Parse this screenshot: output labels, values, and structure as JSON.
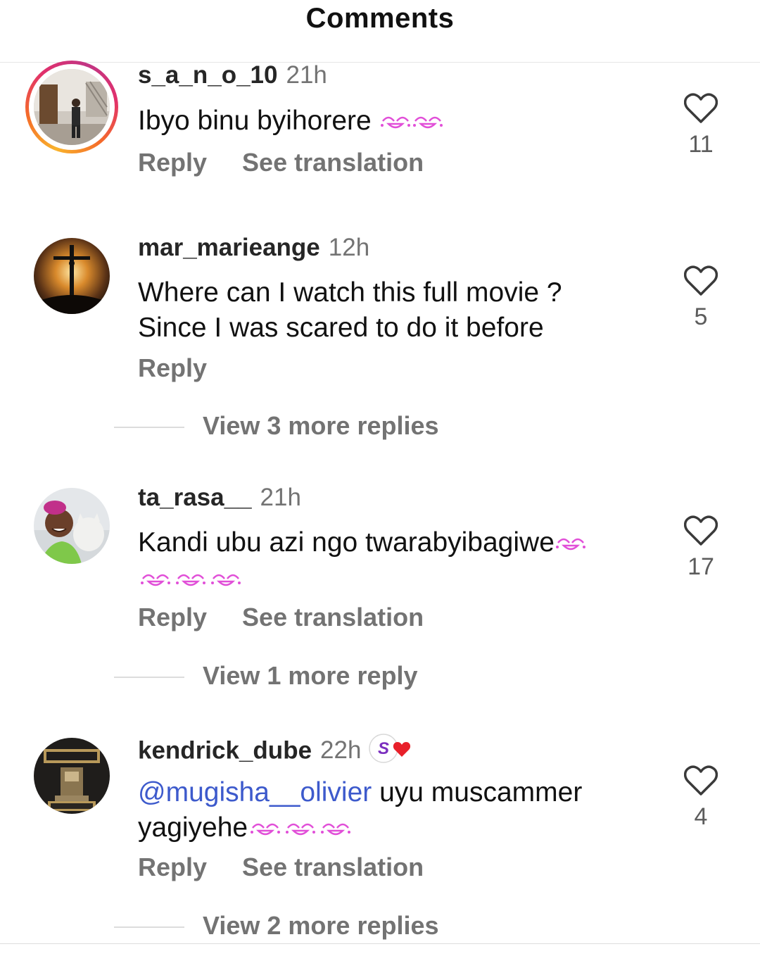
{
  "header": {
    "title": "Comments"
  },
  "comments": [
    {
      "username": "s_a_n_o_10",
      "time": "21h",
      "text": "Ibyo binu byihorere",
      "reply_label": "Reply",
      "translate_label": "See translation",
      "likes": "11",
      "emoji": "smiling-face-with-tear-icon",
      "has_story_ring": true
    },
    {
      "username": "mar_marieange",
      "time": "12h",
      "text_line1": "Where can I watch this full movie ?",
      "text_line2": "Since I was scared to do it before",
      "reply_label": "Reply",
      "likes": "5",
      "more_replies": "View 3 more replies"
    },
    {
      "username": "ta_rasa__",
      "time": "21h",
      "text": "Kandi ubu azi ngo twarabyibagiwe",
      "reply_label": "Reply",
      "translate_label": "See translation",
      "likes": "17",
      "more_replies": "View 1 more reply"
    },
    {
      "username": "kendrick_dube",
      "time": "22h",
      "mention": "@mugisha__olivier",
      "text_line1": " uyu muscammer",
      "text_line2": "yagiyehe",
      "reply_label": "Reply",
      "translate_label": "See translation",
      "likes": "4",
      "more_replies": "View 2 more replies",
      "badge_icon": "creator-badge-icon"
    }
  ],
  "colors": {
    "username": "#262626",
    "secondary": "#737373",
    "mention": "#3d5acc",
    "emoji": "#e14fd8"
  }
}
